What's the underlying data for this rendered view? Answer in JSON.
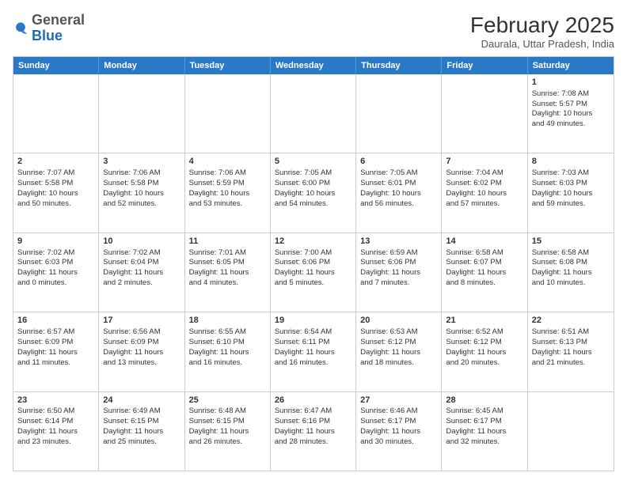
{
  "header": {
    "logo_general": "General",
    "logo_blue": "Blue",
    "month_title": "February 2025",
    "location": "Daurala, Uttar Pradesh, India"
  },
  "weekdays": [
    "Sunday",
    "Monday",
    "Tuesday",
    "Wednesday",
    "Thursday",
    "Friday",
    "Saturday"
  ],
  "weeks": [
    [
      {
        "day": "",
        "info": ""
      },
      {
        "day": "",
        "info": ""
      },
      {
        "day": "",
        "info": ""
      },
      {
        "day": "",
        "info": ""
      },
      {
        "day": "",
        "info": ""
      },
      {
        "day": "",
        "info": ""
      },
      {
        "day": "1",
        "info": "Sunrise: 7:08 AM\nSunset: 5:57 PM\nDaylight: 10 hours\nand 49 minutes."
      }
    ],
    [
      {
        "day": "2",
        "info": "Sunrise: 7:07 AM\nSunset: 5:58 PM\nDaylight: 10 hours\nand 50 minutes."
      },
      {
        "day": "3",
        "info": "Sunrise: 7:06 AM\nSunset: 5:58 PM\nDaylight: 10 hours\nand 52 minutes."
      },
      {
        "day": "4",
        "info": "Sunrise: 7:06 AM\nSunset: 5:59 PM\nDaylight: 10 hours\nand 53 minutes."
      },
      {
        "day": "5",
        "info": "Sunrise: 7:05 AM\nSunset: 6:00 PM\nDaylight: 10 hours\nand 54 minutes."
      },
      {
        "day": "6",
        "info": "Sunrise: 7:05 AM\nSunset: 6:01 PM\nDaylight: 10 hours\nand 56 minutes."
      },
      {
        "day": "7",
        "info": "Sunrise: 7:04 AM\nSunset: 6:02 PM\nDaylight: 10 hours\nand 57 minutes."
      },
      {
        "day": "8",
        "info": "Sunrise: 7:03 AM\nSunset: 6:03 PM\nDaylight: 10 hours\nand 59 minutes."
      }
    ],
    [
      {
        "day": "9",
        "info": "Sunrise: 7:02 AM\nSunset: 6:03 PM\nDaylight: 11 hours\nand 0 minutes."
      },
      {
        "day": "10",
        "info": "Sunrise: 7:02 AM\nSunset: 6:04 PM\nDaylight: 11 hours\nand 2 minutes."
      },
      {
        "day": "11",
        "info": "Sunrise: 7:01 AM\nSunset: 6:05 PM\nDaylight: 11 hours\nand 4 minutes."
      },
      {
        "day": "12",
        "info": "Sunrise: 7:00 AM\nSunset: 6:06 PM\nDaylight: 11 hours\nand 5 minutes."
      },
      {
        "day": "13",
        "info": "Sunrise: 6:59 AM\nSunset: 6:06 PM\nDaylight: 11 hours\nand 7 minutes."
      },
      {
        "day": "14",
        "info": "Sunrise: 6:58 AM\nSunset: 6:07 PM\nDaylight: 11 hours\nand 8 minutes."
      },
      {
        "day": "15",
        "info": "Sunrise: 6:58 AM\nSunset: 6:08 PM\nDaylight: 11 hours\nand 10 minutes."
      }
    ],
    [
      {
        "day": "16",
        "info": "Sunrise: 6:57 AM\nSunset: 6:09 PM\nDaylight: 11 hours\nand 11 minutes."
      },
      {
        "day": "17",
        "info": "Sunrise: 6:56 AM\nSunset: 6:09 PM\nDaylight: 11 hours\nand 13 minutes."
      },
      {
        "day": "18",
        "info": "Sunrise: 6:55 AM\nSunset: 6:10 PM\nDaylight: 11 hours\nand 16 minutes."
      },
      {
        "day": "19",
        "info": "Sunrise: 6:54 AM\nSunset: 6:11 PM\nDaylight: 11 hours\nand 16 minutes."
      },
      {
        "day": "20",
        "info": "Sunrise: 6:53 AM\nSunset: 6:12 PM\nDaylight: 11 hours\nand 18 minutes."
      },
      {
        "day": "21",
        "info": "Sunrise: 6:52 AM\nSunset: 6:12 PM\nDaylight: 11 hours\nand 20 minutes."
      },
      {
        "day": "22",
        "info": "Sunrise: 6:51 AM\nSunset: 6:13 PM\nDaylight: 11 hours\nand 21 minutes."
      }
    ],
    [
      {
        "day": "23",
        "info": "Sunrise: 6:50 AM\nSunset: 6:14 PM\nDaylight: 11 hours\nand 23 minutes."
      },
      {
        "day": "24",
        "info": "Sunrise: 6:49 AM\nSunset: 6:15 PM\nDaylight: 11 hours\nand 25 minutes."
      },
      {
        "day": "25",
        "info": "Sunrise: 6:48 AM\nSunset: 6:15 PM\nDaylight: 11 hours\nand 26 minutes."
      },
      {
        "day": "26",
        "info": "Sunrise: 6:47 AM\nSunset: 6:16 PM\nDaylight: 11 hours\nand 28 minutes."
      },
      {
        "day": "27",
        "info": "Sunrise: 6:46 AM\nSunset: 6:17 PM\nDaylight: 11 hours\nand 30 minutes."
      },
      {
        "day": "28",
        "info": "Sunrise: 6:45 AM\nSunset: 6:17 PM\nDaylight: 11 hours\nand 32 minutes."
      },
      {
        "day": "",
        "info": ""
      }
    ]
  ]
}
